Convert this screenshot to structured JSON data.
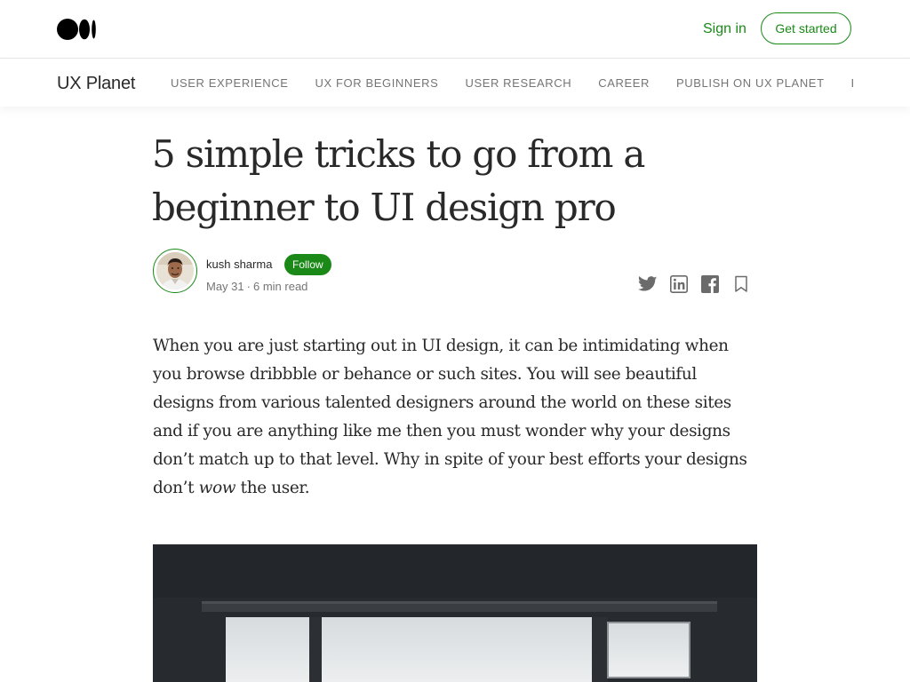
{
  "header": {
    "signin_label": "Sign in",
    "get_started_label": "Get started"
  },
  "publication": {
    "name": "UX Planet",
    "nav": [
      "USER EXPERIENCE",
      "UX FOR BEGINNERS",
      "USER RESEARCH",
      "CAREER",
      "PUBLISH ON UX PLANET",
      "ES"
    ]
  },
  "article": {
    "title": "5 simple tricks to go from a beginner to UI design pro",
    "author": {
      "name": "kush sharma",
      "follow_label": "Follow",
      "date": "May 31",
      "separator": "·",
      "read_time": "6 min read"
    },
    "share_icons": [
      "twitter-icon",
      "linkedin-icon",
      "facebook-icon",
      "bookmark-icon"
    ],
    "intro_before_wow": "When you are just starting out in UI design, it can be intimidating when you browse dribbble or behance or such sites. You will see beautiful designs from various talented designers around the world on these sites and if you are anything like me then you must wonder why your designs don’t match up to that level. Why in spite of your best efforts your designs don’t ",
    "intro_emphasis": "wow",
    "intro_after_wow": " the user."
  },
  "colors": {
    "accent": "#1a8917",
    "text": "#292929",
    "muted": "#757575"
  }
}
